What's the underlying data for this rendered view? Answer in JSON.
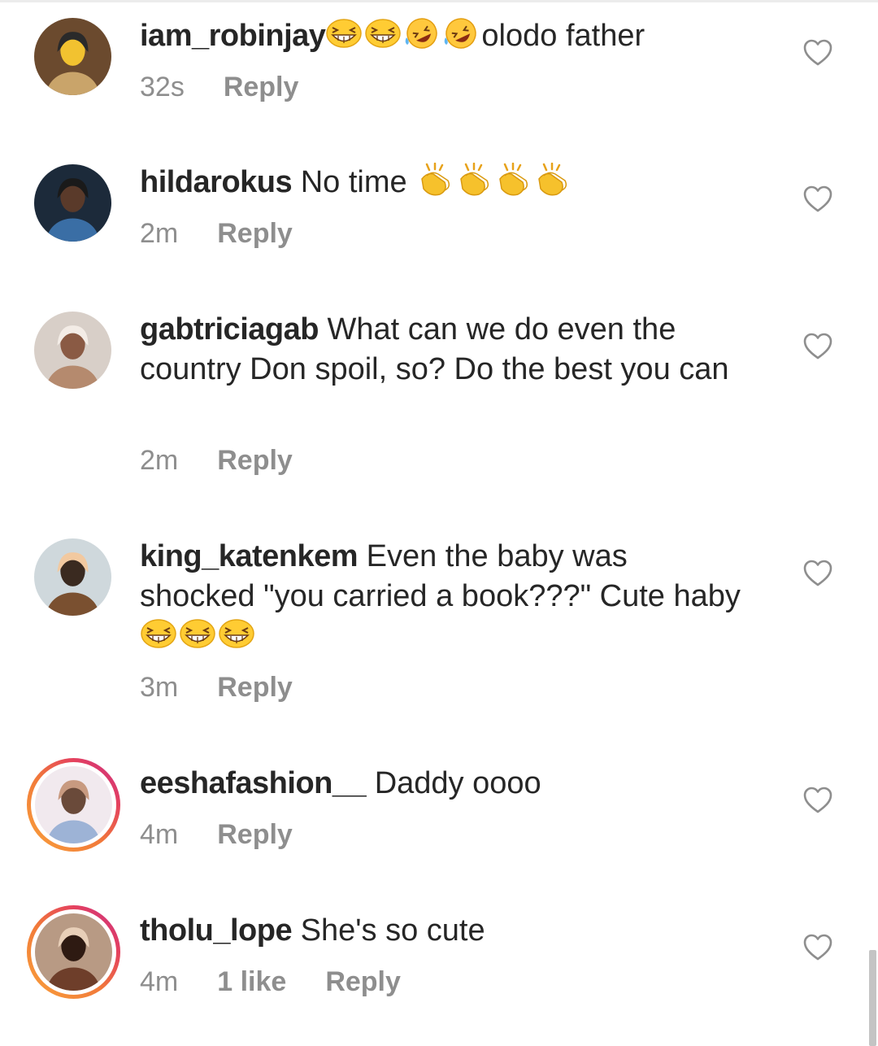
{
  "comments": [
    {
      "username": "iam_robinjay",
      "text_parts": [
        {
          "type": "emoji",
          "name": "grinning-squint"
        },
        {
          "type": "emoji",
          "name": "grinning-squint"
        },
        {
          "type": "emoji",
          "name": "rofl"
        },
        {
          "type": "emoji",
          "name": "rofl"
        },
        {
          "type": "text",
          "value": "olodo father"
        }
      ],
      "time": "32s",
      "likes": "",
      "reply_label": "Reply",
      "story_ring": false
    },
    {
      "username": "hildarokus",
      "text_parts": [
        {
          "type": "text",
          "value": " No time "
        },
        {
          "type": "emoji",
          "name": "clapping-hands"
        },
        {
          "type": "emoji",
          "name": "clapping-hands"
        },
        {
          "type": "emoji",
          "name": "clapping-hands"
        },
        {
          "type": "emoji",
          "name": "clapping-hands"
        }
      ],
      "time": "2m",
      "likes": "",
      "reply_label": "Reply",
      "story_ring": false
    },
    {
      "username": "gabtriciagab",
      "text_parts": [
        {
          "type": "text",
          "value": " What can we do even the country Don spoil,  so? Do the best you can"
        }
      ],
      "time": "2m",
      "likes": "",
      "reply_label": "Reply",
      "story_ring": false
    },
    {
      "username": "king_katenkem",
      "text_parts": [
        {
          "type": "text",
          "value": " Even the baby was shocked \"you carried a book???\" Cute haby"
        },
        {
          "type": "emoji",
          "name": "grinning-squint"
        },
        {
          "type": "emoji",
          "name": "grinning-squint"
        },
        {
          "type": "emoji",
          "name": "grinning-squint"
        }
      ],
      "time": "3m",
      "likes": "",
      "reply_label": "Reply",
      "story_ring": false
    },
    {
      "username": "eeshafashion__",
      "text_parts": [
        {
          "type": "text",
          "value": " Daddy oooo"
        }
      ],
      "time": "4m",
      "likes": "",
      "reply_label": "Reply",
      "story_ring": true
    },
    {
      "username": "tholu_lope",
      "text_parts": [
        {
          "type": "text",
          "value": " She's so cute"
        }
      ],
      "time": "4m",
      "likes": "1 like",
      "reply_label": "Reply",
      "story_ring": true
    }
  ],
  "icons": {
    "like": "heart-outline-icon"
  },
  "colors": {
    "text": "#262626",
    "meta": "#8e8e8e",
    "emoji_face": "#ffcc33",
    "ring_start": "#f9a13a",
    "ring_end": "#c62f8a"
  }
}
